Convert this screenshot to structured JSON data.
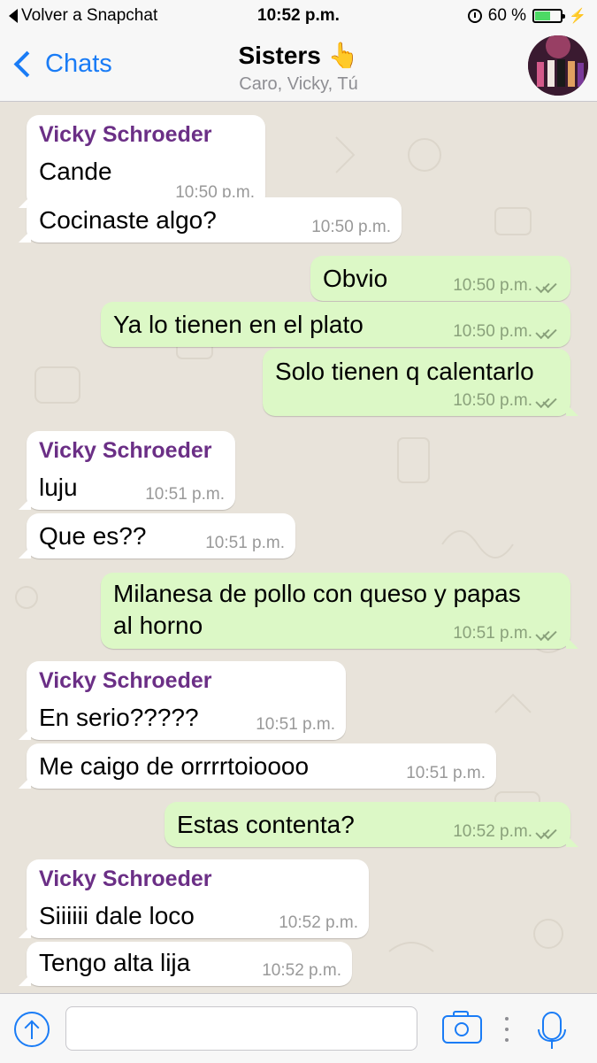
{
  "status_bar": {
    "back_label": "Volver a Snapchat",
    "time": "10:52 p.m.",
    "battery": "60 %",
    "battery_level": 0.6
  },
  "header": {
    "back_label": "Chats",
    "title": "Sisters 👆",
    "subtitle": "Caro, Vicky, Tú"
  },
  "messages": [
    {
      "sender": "Vicky Schroeder",
      "text": "Cande",
      "time": "10:50 p.m."
    },
    {
      "text": "Cocinaste algo?",
      "time": "10:50 p.m."
    },
    {
      "text": "Obvio",
      "time": "10:50 p.m."
    },
    {
      "text": "Ya lo tienen en el plato",
      "time": "10:50 p.m."
    },
    {
      "text": "Solo tienen q calentarlo",
      "time": "10:50 p.m."
    },
    {
      "sender": "Vicky Schroeder",
      "text": "luju",
      "time": "10:51 p.m."
    },
    {
      "text": "Que es??",
      "time": "10:51 p.m."
    },
    {
      "text_line1": "Milanesa de pollo con queso y papas",
      "text_line2": "al horno",
      "time": "10:51 p.m."
    },
    {
      "sender": "Vicky Schroeder",
      "text": "En serio?????",
      "time": "10:51 p.m."
    },
    {
      "text": "Me caigo de orrrrtoioooo",
      "time": "10:51 p.m."
    },
    {
      "text": "Estas contenta?",
      "time": "10:52 p.m."
    },
    {
      "sender": "Vicky Schroeder",
      "text": "Siiiiii dale loco",
      "time": "10:52 p.m."
    },
    {
      "text": "Tengo alta lija",
      "time": "10:52 p.m."
    }
  ],
  "colors": {
    "accent": "#1a7cf6",
    "outgoing_bubble": "#dcf8c6",
    "incoming_bubble": "#ffffff",
    "sender_name": "#6b2f86",
    "chat_background": "#e8e3da"
  },
  "icons": {
    "upload": "arrow-up-circle-icon",
    "camera": "camera-icon",
    "mic": "microphone-icon",
    "more": "vertical-dots-icon"
  }
}
